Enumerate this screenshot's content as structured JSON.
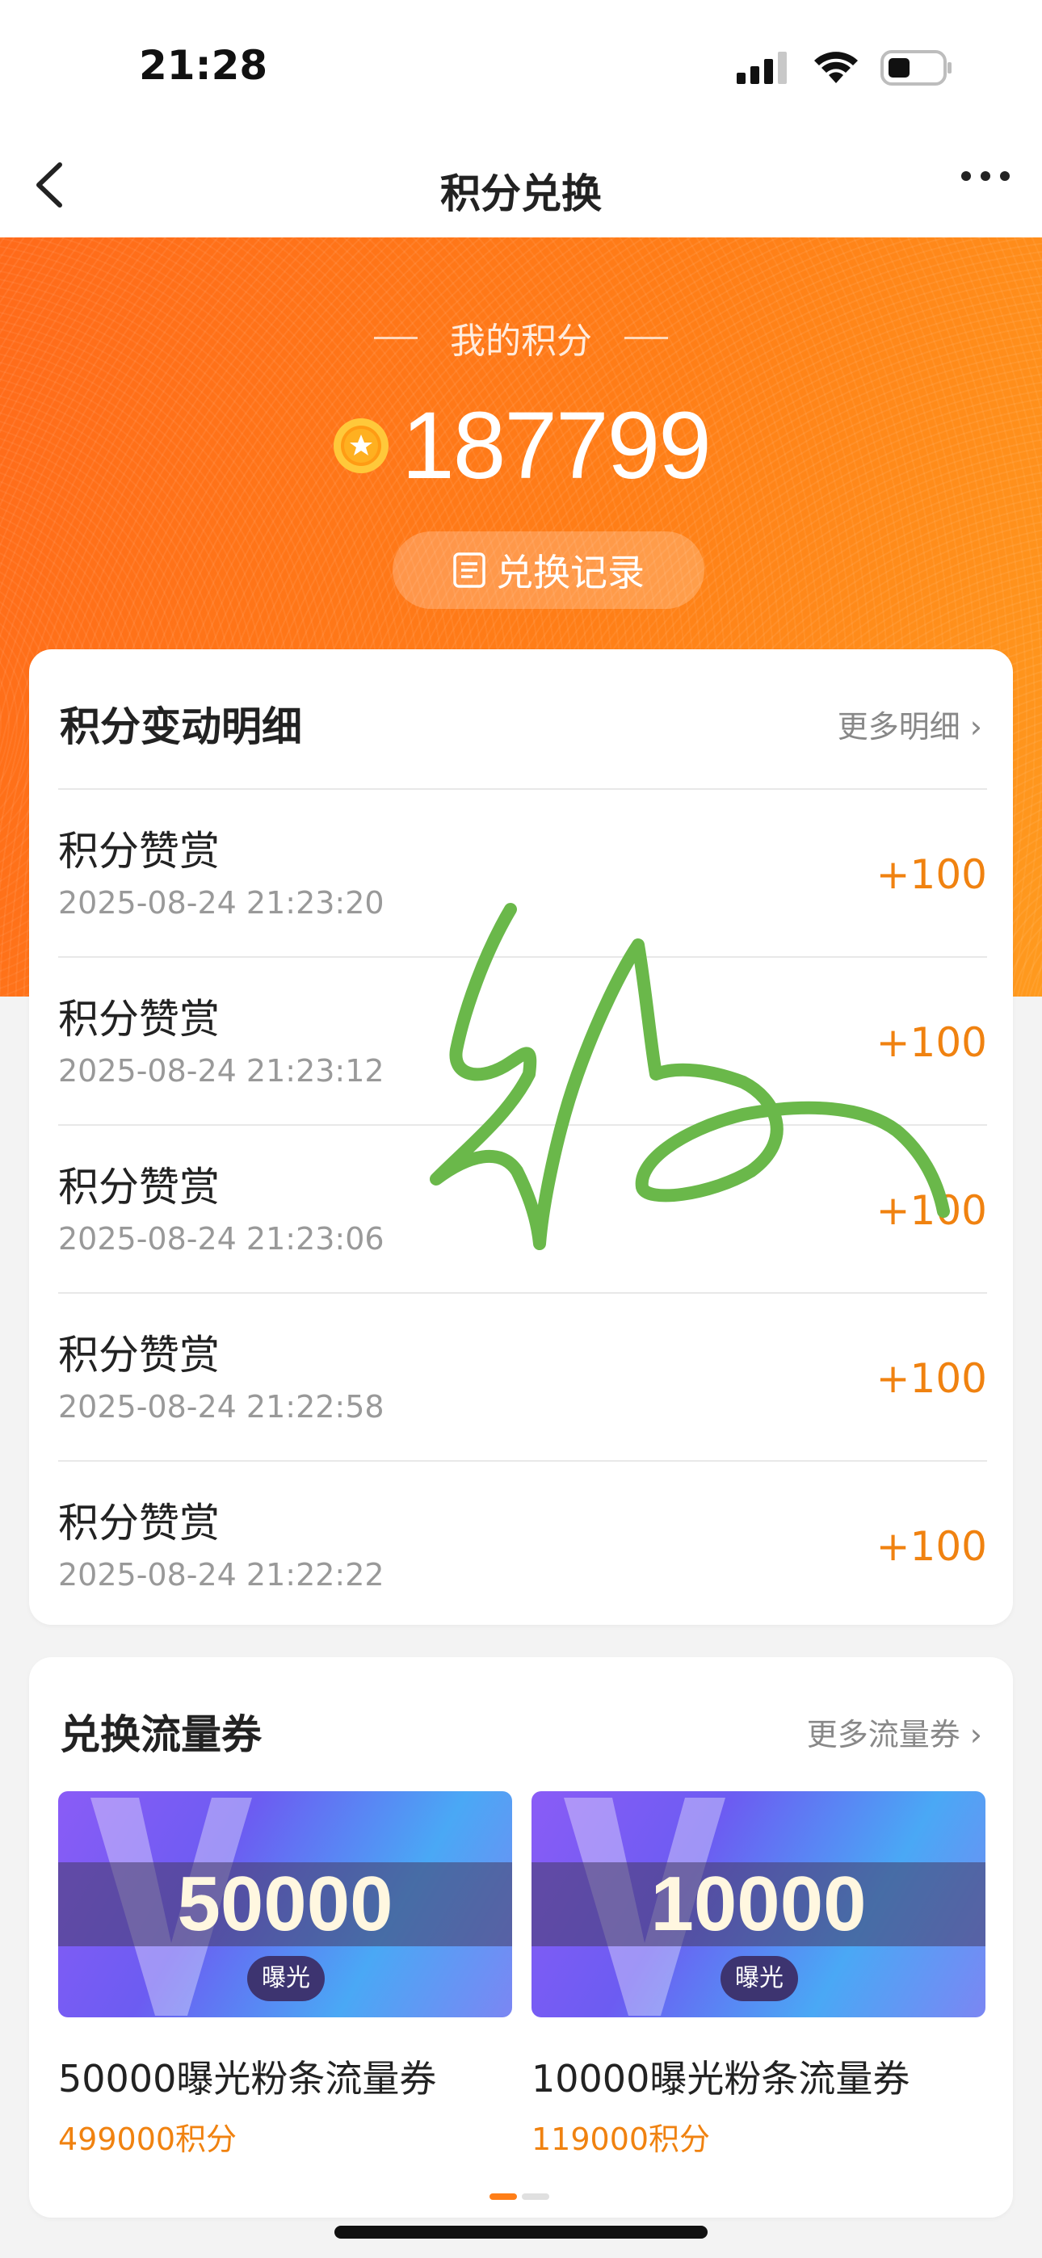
{
  "status": {
    "time": "21:28",
    "icons": [
      "signal-icon",
      "wifi-icon",
      "battery-icon"
    ]
  },
  "nav": {
    "title": "积分兑换",
    "back_icon": "chevron-left-icon",
    "more_icon": "more-dots-icon"
  },
  "hero": {
    "label": "我的积分",
    "points": "187799",
    "coin_icon": "coin-star-icon",
    "records_button": "兑换记录",
    "records_icon": "list-doc-icon",
    "colors": {
      "start": "#ff6a1a",
      "end": "#ff9a1e"
    }
  },
  "detail": {
    "title": "积分变动明细",
    "more": "更多明细 ›",
    "items": [
      {
        "title": "积分赞赏",
        "time": "2025-08-24 21:23:20",
        "amount": "+100"
      },
      {
        "title": "积分赞赏",
        "time": "2025-08-24 21:23:12",
        "amount": "+100"
      },
      {
        "title": "积分赞赏",
        "time": "2025-08-24 21:23:06",
        "amount": "+100"
      },
      {
        "title": "积分赞赏",
        "time": "2025-08-24 21:22:58",
        "amount": "+100"
      },
      {
        "title": "积分赞赏",
        "time": "2025-08-24 21:22:22",
        "amount": "+100"
      }
    ]
  },
  "vouchers": {
    "title": "兑换流量券",
    "more": "更多流量券 ›",
    "items": [
      {
        "number": "50000",
        "tag": "曝光",
        "name": "50000曝光粉条流量券",
        "price": "499000积分"
      },
      {
        "number": "10000",
        "tag": "曝光",
        "name": "10000曝光粉条流量券",
        "price": "119000积分"
      }
    ]
  },
  "accent_color": "#f08210",
  "signature_color": "#6ab84a"
}
